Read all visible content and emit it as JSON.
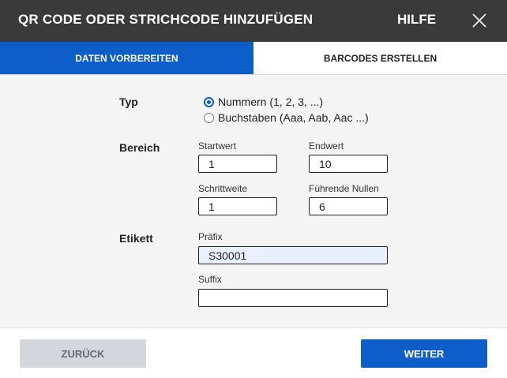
{
  "dialog": {
    "title": "QR CODE ODER STRICHCODE HINZUFÜGEN",
    "help_label": "HILFE",
    "close_icon": "close-icon"
  },
  "tabs": [
    {
      "label": "DATEN VORBEREITEN",
      "active": true
    },
    {
      "label": "BARCODES ERSTELLEN",
      "active": false
    }
  ],
  "typ": {
    "label": "Typ",
    "options": [
      {
        "label": "Nummern (1, 2, 3, ...)",
        "checked": true
      },
      {
        "label": "Buchstaben (Aaa, Aab, Aac ...)",
        "checked": false
      }
    ]
  },
  "bereich": {
    "label": "Bereich",
    "startwert": {
      "label": "Startwert",
      "value": "1"
    },
    "endwert": {
      "label": "Endwert",
      "value": "10"
    },
    "schrittweite": {
      "label": "Schrittweite",
      "value": "1"
    },
    "fuehrende_nullen": {
      "label": "Führende Nullen",
      "value": "6"
    }
  },
  "etikett": {
    "label": "Etikett",
    "praefix": {
      "label": "Präfix",
      "value": "S30001"
    },
    "suffix": {
      "label": "Suffix",
      "value": ""
    }
  },
  "footer": {
    "back_label": "ZURÜCK",
    "next_label": "WEITER"
  },
  "colors": {
    "accent": "#0d5ec9",
    "titlebar": "#3a3a3a",
    "content_bg": "#f4f4f4",
    "back_button": "#d3d6da"
  }
}
